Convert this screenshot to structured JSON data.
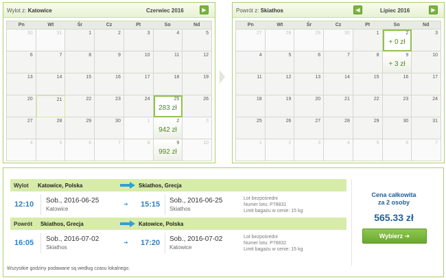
{
  "outbound": {
    "label": "Wylot z:",
    "city": "Katowice",
    "month": "Czerwiec 2016",
    "weekdays": [
      "Pn",
      "Wt",
      "Śr",
      "Cz",
      "Pt",
      "So",
      "Nd"
    ],
    "days": [
      {
        "n": "30",
        "other": true
      },
      {
        "n": "31",
        "other": true
      },
      {
        "n": "1"
      },
      {
        "n": "2"
      },
      {
        "n": "3"
      },
      {
        "n": "4"
      },
      {
        "n": "5"
      },
      {
        "n": "6"
      },
      {
        "n": "7"
      },
      {
        "n": "8"
      },
      {
        "n": "9"
      },
      {
        "n": "10"
      },
      {
        "n": "11"
      },
      {
        "n": "12"
      },
      {
        "n": "13"
      },
      {
        "n": "14"
      },
      {
        "n": "15"
      },
      {
        "n": "16"
      },
      {
        "n": "17"
      },
      {
        "n": "18"
      },
      {
        "n": "19"
      },
      {
        "n": "20"
      },
      {
        "n": "21",
        "today": true
      },
      {
        "n": "22"
      },
      {
        "n": "23"
      },
      {
        "n": "24"
      },
      {
        "n": "25",
        "price": "283 zł",
        "selected": true
      },
      {
        "n": "26"
      },
      {
        "n": "27"
      },
      {
        "n": "28"
      },
      {
        "n": "29"
      },
      {
        "n": "30"
      },
      {
        "n": "1",
        "other": true
      },
      {
        "n": "2",
        "price": "942 zł"
      },
      {
        "n": "3",
        "other": true
      },
      {
        "n": "4",
        "other": true
      },
      {
        "n": "5",
        "other": true
      },
      {
        "n": "6",
        "other": true
      },
      {
        "n": "7",
        "other": true
      },
      {
        "n": "8",
        "other": true
      },
      {
        "n": "9",
        "price": "992 zł"
      },
      {
        "n": "10",
        "other": true
      }
    ]
  },
  "return": {
    "label": "Powrót z:",
    "city": "Skiathos",
    "month": "Lipiec 2016",
    "weekdays": [
      "Pn",
      "Wt",
      "Śr",
      "Cz",
      "Pt",
      "So",
      "Nd"
    ],
    "days": [
      {
        "n": "27",
        "other": true
      },
      {
        "n": "28",
        "other": true
      },
      {
        "n": "29",
        "other": true
      },
      {
        "n": "30",
        "other": true
      },
      {
        "n": "1"
      },
      {
        "n": "2",
        "price": "+ 0 zł",
        "selected": true
      },
      {
        "n": "3"
      },
      {
        "n": "4"
      },
      {
        "n": "5"
      },
      {
        "n": "6"
      },
      {
        "n": "7"
      },
      {
        "n": "8"
      },
      {
        "n": "9",
        "price": "+ 3 zł"
      },
      {
        "n": "10"
      },
      {
        "n": "11"
      },
      {
        "n": "12"
      },
      {
        "n": "13"
      },
      {
        "n": "14"
      },
      {
        "n": "15"
      },
      {
        "n": "16"
      },
      {
        "n": "17"
      },
      {
        "n": "18"
      },
      {
        "n": "19"
      },
      {
        "n": "20"
      },
      {
        "n": "21"
      },
      {
        "n": "22"
      },
      {
        "n": "23"
      },
      {
        "n": "24"
      },
      {
        "n": "25"
      },
      {
        "n": "26"
      },
      {
        "n": "27"
      },
      {
        "n": "28"
      },
      {
        "n": "29"
      },
      {
        "n": "30"
      },
      {
        "n": "31"
      },
      {
        "n": "1",
        "other": true
      },
      {
        "n": "2",
        "other": true
      },
      {
        "n": "3",
        "other": true
      },
      {
        "n": "4",
        "other": true
      },
      {
        "n": "5",
        "other": true
      },
      {
        "n": "6",
        "other": true
      },
      {
        "n": "7",
        "other": true
      }
    ]
  },
  "nav": {
    "prev": "◀",
    "next": "▶"
  },
  "legs": [
    {
      "title": "Wylot",
      "from": "Katowice, Polska",
      "to": "Skiathos, Grecja",
      "dep_time": "12:10",
      "dep_date": "Sob., 2016-06-25",
      "dep_city": "Katowice",
      "arr_time": "15:15",
      "arr_date": "Sob., 2016-06-25",
      "arr_city": "Skiathos",
      "info1": "Lot bezpośredni",
      "info2": "Numer lotu: P78831",
      "info3": "Limit bagażu w cenie: 15 kg"
    },
    {
      "title": "Powrót",
      "from": "Skiathos, Grecja",
      "to": "Katowice, Polska",
      "dep_time": "16:05",
      "dep_date": "Sob., 2016-07-02",
      "dep_city": "Skiathos",
      "arr_time": "17:20",
      "arr_date": "Sob., 2016-07-02",
      "arr_city": "Katowice",
      "info1": "Lot bezpośredni",
      "info2": "Numer lotu: P78832",
      "info3": "Limit bagażu w cenie: 15 kg"
    }
  ],
  "price": {
    "label_line1": "Cena całkowita",
    "label_line2": "za 2 osoby",
    "amount": "565.33 zł",
    "button": "Wybierz"
  },
  "note": "Wszystkie godziny podawane są według czasu lokalnego."
}
